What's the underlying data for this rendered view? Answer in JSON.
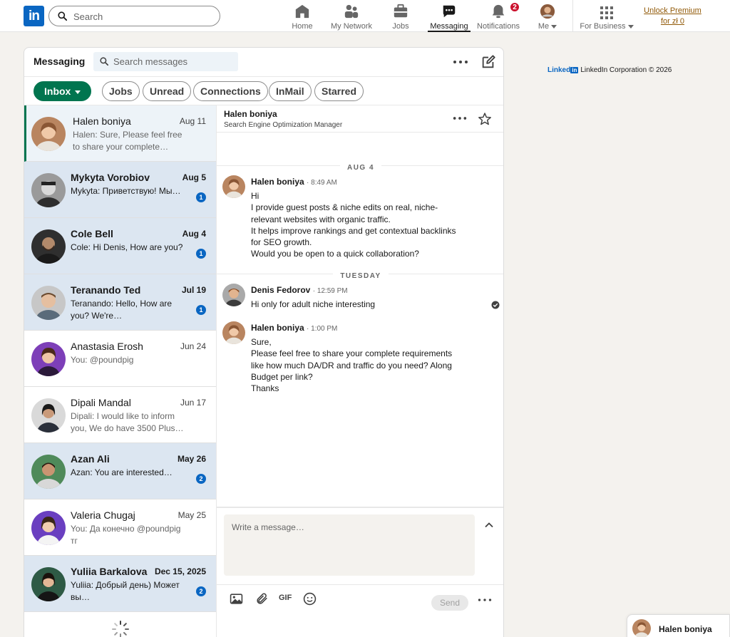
{
  "topnav": {
    "logo_text": "in",
    "search_placeholder": "Search",
    "items": [
      {
        "label": "Home",
        "icon": "home-icon"
      },
      {
        "label": "My Network",
        "icon": "people-icon"
      },
      {
        "label": "Jobs",
        "icon": "briefcase-icon"
      },
      {
        "label": "Messaging",
        "icon": "chat-icon",
        "active": true
      },
      {
        "label": "Notifications",
        "icon": "bell-icon",
        "badge": "2"
      },
      {
        "label": "Me",
        "icon": "avatar"
      },
      {
        "label": "For Business",
        "icon": "grid-icon"
      }
    ],
    "premium_line1": "Unlock Premium",
    "premium_line2": "for zł 0"
  },
  "messaging": {
    "title": "Messaging",
    "search_placeholder": "Search messages",
    "filters": [
      "Inbox",
      "Jobs",
      "Unread",
      "Connections",
      "InMail",
      "Starred"
    ],
    "conversations": [
      {
        "name": "Halen boniya",
        "date": "Aug 11",
        "snippet": "Halen: Sure, Please feel free to share your complete…",
        "unread": false,
        "selected": true
      },
      {
        "name": "Mykyta Vorobiov",
        "date": "Aug 5",
        "snippet": "Mykyta: Приветствую! Мы…",
        "unread": true,
        "count": "1"
      },
      {
        "name": "Cole Bell",
        "date": "Aug 4",
        "snippet": "Cole: Hi Denis,   How are you?",
        "unread": true,
        "count": "1"
      },
      {
        "name": "Teranando Ted",
        "date": "Jul 19",
        "snippet": "Teranando: Hello, How are you? We're…",
        "unread": true,
        "count": "1"
      },
      {
        "name": "Anastasia Erosh",
        "date": "Jun 24",
        "snippet": "You: @poundpig",
        "unread": false
      },
      {
        "name": "Dipali Mandal",
        "date": "Jun 17",
        "snippet": "Dipali: I would like to inform you, We do have 3500 Plus…",
        "unread": false
      },
      {
        "name": "Azan Ali",
        "date": "May 26",
        "snippet": "Azan: You are interested…",
        "unread": true,
        "count": "2"
      },
      {
        "name": "Valeria Chugaj",
        "date": "May 25",
        "snippet": "You: Да конечно @poundpig тг",
        "unread": false
      },
      {
        "name": "Yuliia Barkalova",
        "date": "Dec 15, 2025",
        "snippet": "Yuliia: Добрый день) Может вы…",
        "unread": true,
        "count": "2"
      }
    ]
  },
  "thread": {
    "name": "Halen boniya",
    "subtitle": "Search Engine Optimization Manager",
    "day1": "AUG 4",
    "day2": "TUESDAY",
    "messages": [
      {
        "sender": "Halen boniya",
        "time": "8:49 AM",
        "lines": [
          "Hi",
          "I provide guest posts & niche edits on real, niche-relevant websites with organic traffic.",
          "It helps improve rankings and get contextual backlinks for SEO growth.",
          "Would you be open to a quick collaboration?"
        ]
      },
      {
        "sender": "Denis Fedorov",
        "time": "12:59 PM",
        "lines": [
          "Hi only for adult niche interesting"
        ]
      },
      {
        "sender": "Halen boniya",
        "time": "1:00 PM",
        "lines": [
          "Sure,",
          "Please feel free to share your complete requirements like how much DA/DR and traffic do you need? Along Budget per link?",
          "Thanks"
        ]
      }
    ],
    "compose_placeholder": "Write a message…",
    "gif_label": "GIF",
    "send_label": "Send"
  },
  "footer": {
    "brand_word": "Linked",
    "brand_box": "in",
    "corp": "LinkedIn Corporation © 2026"
  },
  "mini_chat": {
    "name": "Halen boniya"
  },
  "colors": {
    "brand": "#0a66c2",
    "inbox_green": "#01754f",
    "unread_bg": "#dce6f1",
    "badge_red": "#cb112d",
    "premium": "#915907"
  }
}
